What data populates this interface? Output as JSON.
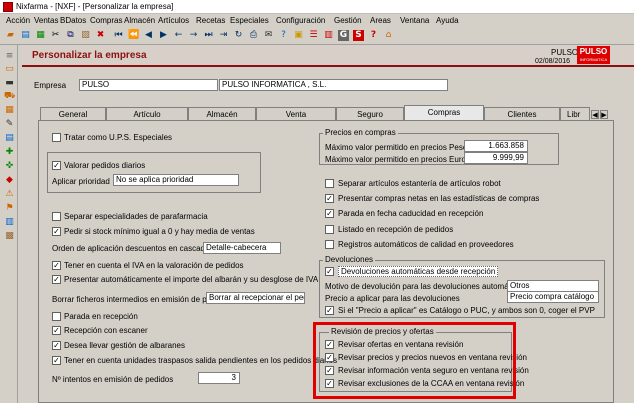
{
  "window": {
    "title": "Nixfarma - [NXF] - [Personalizar la empresa]"
  },
  "menu": [
    "Acción",
    "Ventas",
    "BDatos",
    "Compras",
    "Almacén",
    "Artículos",
    "Recetas",
    "Especiales",
    "Configuración",
    "Gestión",
    "Areas",
    "Ventana",
    "Ayuda"
  ],
  "header": {
    "title": "Personalizar la empresa",
    "company": "PULSO",
    "date": "02/08/2016",
    "logo": "PULSO",
    "logo_sub": "INFORMATICA"
  },
  "empresa": {
    "label": "Empresa",
    "code": "PULSO",
    "name": "PULSO INFORMATICA , S.L."
  },
  "tabs": [
    "General",
    "Artículo",
    "Almacén",
    "Venta",
    "Seguro",
    "Compras",
    "Clientes",
    "Libr"
  ],
  "left": {
    "tratar_ups": "Tratar como U.P.S. Especiales",
    "valorar": "Valorar pedidos diarios",
    "aplicar_prioridad_label": "Aplicar prioridad",
    "aplicar_prioridad_value": "No se aplica prioridad",
    "separar_parafarmacia": "Separar especialidades de parafarmacia",
    "pedir_stock": "Pedir si stock mínimo igual a 0 y hay media de ventas",
    "orden_label": "Orden de aplicación descuentos en cascada",
    "orden_value": "Detalle-cabecera",
    "tener_iva": "Tener en cuenta el IVA en la valoración de pedidos",
    "presentar_importe": "Presentar automáticamente el importe del albarán y su desglose de IVA",
    "borrar_label": "Borrar ficheros intermedios en emisión de pedidos",
    "borrar_value": "Borrar al recepcionar el pedido",
    "parada_recepcion": "Parada en recepción",
    "recepcion_escaner": "Recepción con escaner",
    "desea_gestion": "Desea llevar gestión de albaranes",
    "tener_traspasos": "Tener en cuenta unidades traspasos salida pendientes en los pedidos diarios",
    "intentos_label": "Nº intentos en emisión de pedidos",
    "intentos_value": "3"
  },
  "precios": {
    "title": "Precios en compras",
    "pesetas_label": "Máximo valor permitido en precios Pesetas",
    "pesetas_value": "1.663.858",
    "euros_label": "Máximo valor permitido en precios Euros",
    "euros_value": "9.999,99"
  },
  "right": {
    "separar_robot": "Separar artículos estantería de artículos robot",
    "presentar_netas": "Presentar compras netas en las estadísticas de compras",
    "parada_caducidad": "Parada en fecha caducidad en recepción",
    "listado_recepcion": "Listado en recepción de pedidos",
    "registros_calidad": "Registros automáticos de calidad en proveedores"
  },
  "devoluciones": {
    "title": "Devoluciones",
    "automaticas": "Devoluciones automáticas desde recepción",
    "motivo_label": "Motivo de devolución para las devoluciones automáticas",
    "motivo_value": "Otros",
    "precio_label": "Precio a aplicar para las devoluciones",
    "precio_value": "Precio compra catálogo",
    "si_precio": "Si el \"Precio a aplicar\" es Catálogo o PUC, y ambos son 0, coger el PVP"
  },
  "revision": {
    "title": "Revisión de precios y ofertas",
    "items": [
      "Revisar ofertas en ventana revisión",
      "Revisar precios y precios nuevos en ventana revisión",
      "Revisar información venta seguro en ventana revisión",
      "Revisar exclusiones de la CCAA en ventana revisión"
    ]
  },
  "colors": {
    "accent": "#8b1010",
    "highlight": "#e00000",
    "logo": "#dd0000"
  }
}
